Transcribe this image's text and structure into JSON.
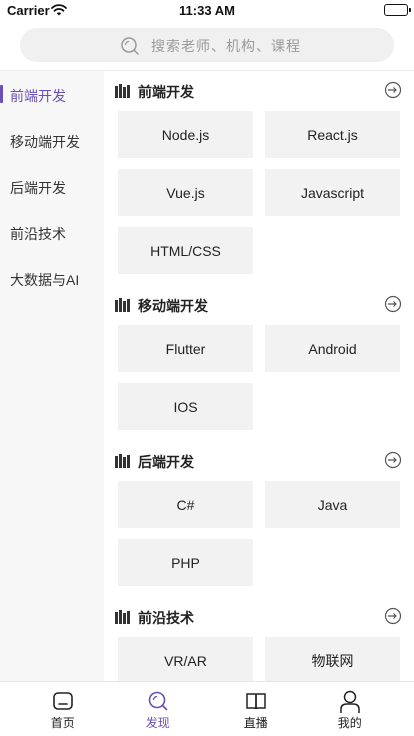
{
  "status_bar": {
    "carrier": "Carrier",
    "time": "11:33 AM",
    "battery_level": 1.0
  },
  "search": {
    "placeholder": "搜索老师、机构、课程"
  },
  "sidebar": {
    "active_index": 0,
    "items": [
      {
        "label": "前端开发"
      },
      {
        "label": "移动端开发"
      },
      {
        "label": "后端开发"
      },
      {
        "label": "前沿技术"
      },
      {
        "label": "大数据与AI"
      }
    ]
  },
  "sections": [
    {
      "title": "前端开发",
      "items": [
        "Node.js",
        "React.js",
        "Vue.js",
        "Javascript",
        "HTML/CSS"
      ]
    },
    {
      "title": "移动端开发",
      "items": [
        "Flutter",
        "Android",
        "IOS"
      ]
    },
    {
      "title": "后端开发",
      "items": [
        "C#",
        "Java",
        "PHP"
      ]
    },
    {
      "title": "前沿技术",
      "items": [
        "VR/AR",
        "物联网"
      ]
    }
  ],
  "tab_bar": {
    "active_index": 1,
    "tabs": [
      {
        "label": "首页",
        "icon": "home-icon"
      },
      {
        "label": "发现",
        "icon": "discover-icon"
      },
      {
        "label": "直播",
        "icon": "book-icon"
      },
      {
        "label": "我的",
        "icon": "profile-icon"
      }
    ]
  },
  "colors": {
    "accent": "#6a4fb8",
    "tile_bg": "#f2f2f2",
    "sidebar_bg": "#f7f7f7"
  }
}
